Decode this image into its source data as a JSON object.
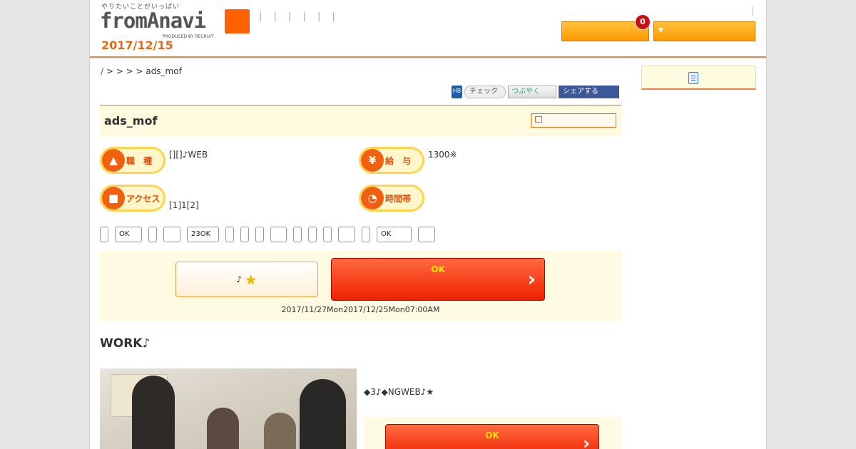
{
  "header": {
    "tagline": "やりたいことがいっぱい",
    "logo": "fromAnavi",
    "logo_sub": "PRODUCED BY RECRUIT",
    "nav_ticks": "| | | | | |",
    "date": "2017/12/15",
    "top_separator": "|",
    "badge_count": "0",
    "caret": "▼",
    "accent_color": "#ff6000"
  },
  "breadcrumb": {
    "home": "/",
    "rest": " > > > > ads_mof"
  },
  "social": {
    "hatena": "HB",
    "mixi": "チェック",
    "twitter": "つぶやく",
    "facebook": "シェアする"
  },
  "job": {
    "title": "ads_mof",
    "labels": {
      "type": "職 種",
      "salary": "給 与",
      "access": "アクセス",
      "hours": "時間帯"
    },
    "icons": {
      "type": "shirt-icon",
      "salary": "yen-icon",
      "access": "train-icon",
      "hours": "clock-icon"
    },
    "type_value": "[][]♪WEB",
    "salary_value": "1300※",
    "access_value": "[1]1[2]",
    "hours_value": ""
  },
  "tags": [
    "",
    "OK",
    "",
    "",
    "23OK",
    "",
    "",
    "",
    "",
    "",
    "",
    "",
    "",
    "",
    "OK",
    ""
  ],
  "apply": {
    "fav_label": "♪",
    "apply_label": "OK",
    "period": "2017/11/27Mon2017/12/25Mon07:00AM"
  },
  "work": {
    "title": "WORK♪",
    "text": "◆3♪◆NGWEB♪★",
    "apply_label": "OK"
  }
}
